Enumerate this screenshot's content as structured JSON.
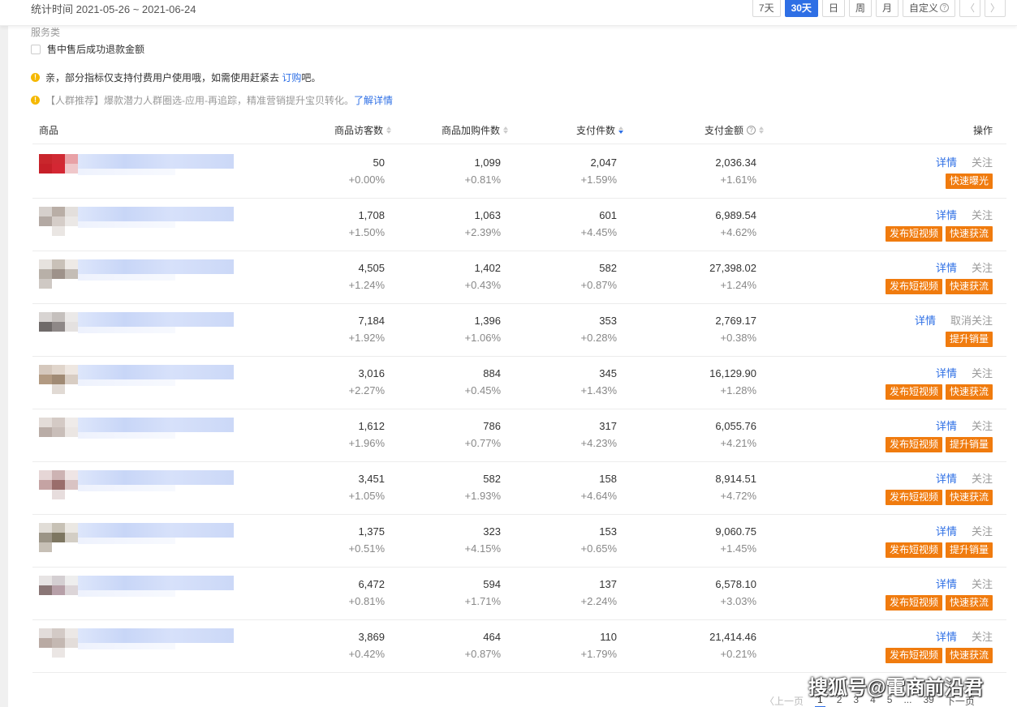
{
  "header": {
    "stat_time": "统计时间 2021-05-26 ~ 2021-06-24",
    "ranges": [
      "7天",
      "30天",
      "日",
      "周",
      "月"
    ],
    "active_range": "30天",
    "custom_label": "自定义",
    "prev_icon": "chevron-left-icon",
    "next_icon": "chevron-right-icon"
  },
  "filters": {
    "group_label": "服务类",
    "item_label": "售中售后成功退款金额"
  },
  "notices": [
    {
      "text": "亲，部分指标仅支持付费用户使用哦，如需使用赶紧去 ",
      "link": "订购",
      "suffix": "吧。"
    },
    {
      "text": "【人群推荐】爆款潜力人群圈选-应用-再追踪，精准营销提升宝贝转化。",
      "link": "了解详情",
      "suffix": ""
    }
  ],
  "table": {
    "columns": {
      "product": "商品",
      "visitors": "商品访客数",
      "cart": "商品加购件数",
      "qty": "支付件数",
      "amount": "支付金额",
      "ops": "操作"
    },
    "rows": [
      {
        "visitors": "50",
        "visitors_chg": "+0.00%",
        "cart": "1,099",
        "cart_chg": "+0.81%",
        "qty": "2,047",
        "qty_chg": "+1.59%",
        "amount": "2,036.34",
        "amount_chg": "+1.61%",
        "detail": "详情",
        "follow": "关注",
        "buttons": [
          "快速曝光"
        ],
        "thumb": [
          "#c9262c",
          "#d02a33",
          "#e8a1a6",
          "#c61f28",
          "#d42733",
          "#efc7ca",
          "#ffffff",
          "#ffffff",
          "#ffffff"
        ]
      },
      {
        "visitors": "1,708",
        "visitors_chg": "+1.50%",
        "cart": "1,063",
        "cart_chg": "+2.39%",
        "qty": "601",
        "qty_chg": "+4.45%",
        "amount": "6,989.54",
        "amount_chg": "+4.62%",
        "detail": "详情",
        "follow": "关注",
        "buttons": [
          "发布短视频",
          "快速获流"
        ],
        "thumb": [
          "#d6d0cc",
          "#b9aea6",
          "#e3dfdc",
          "#b3a9a3",
          "#d5cdc8",
          "#ebe8e6",
          "#ffffff",
          "#eae6e3",
          "#ffffff"
        ]
      },
      {
        "visitors": "4,505",
        "visitors_chg": "+1.24%",
        "cart": "1,402",
        "cart_chg": "+0.43%",
        "qty": "582",
        "qty_chg": "+0.87%",
        "amount": "27,398.02",
        "amount_chg": "+1.24%",
        "detail": "详情",
        "follow": "关注",
        "buttons": [
          "发布短视频",
          "快速获流"
        ],
        "thumb": [
          "#e6e2de",
          "#c9c1b8",
          "#eeeae6",
          "#b8b0a8",
          "#9e928a",
          "#c4bdb6",
          "#cfc9c4",
          "#ffffff",
          "#ffffff"
        ]
      },
      {
        "visitors": "7,184",
        "visitors_chg": "+1.92%",
        "cart": "1,396",
        "cart_chg": "+1.06%",
        "qty": "353",
        "qty_chg": "+0.28%",
        "amount": "2,769.17",
        "amount_chg": "+0.38%",
        "detail": "详情",
        "follow": "取消关注",
        "buttons": [
          "提升销量"
        ],
        "thumb": [
          "#d8d4d2",
          "#c5c0bd",
          "#ebe9e8",
          "#6f6a69",
          "#8e8887",
          "#e4e1e0",
          "#ffffff",
          "#ffffff",
          "#ffffff"
        ]
      },
      {
        "visitors": "3,016",
        "visitors_chg": "+2.27%",
        "cart": "884",
        "cart_chg": "+0.45%",
        "qty": "345",
        "qty_chg": "+1.43%",
        "amount": "16,129.90",
        "amount_chg": "+1.28%",
        "detail": "详情",
        "follow": "关注",
        "buttons": [
          "发布短视频",
          "快速获流"
        ],
        "thumb": [
          "#d5c8bd",
          "#e0d5cb",
          "#eee7e1",
          "#b29a82",
          "#a08a74",
          "#d8cdc3",
          "#ffffff",
          "#e1dad4",
          "#ffffff"
        ]
      },
      {
        "visitors": "1,612",
        "visitors_chg": "+1.96%",
        "cart": "786",
        "cart_chg": "+0.77%",
        "qty": "317",
        "qty_chg": "+4.23%",
        "amount": "6,055.76",
        "amount_chg": "+4.21%",
        "detail": "详情",
        "follow": "关注",
        "buttons": [
          "发布短视频",
          "提升销量"
        ],
        "thumb": [
          "#e3dcd8",
          "#d4cac5",
          "#efebe9",
          "#b9aca6",
          "#c9beb9",
          "#ebe6e3",
          "#ffffff",
          "#ffffff",
          "#ffffff"
        ]
      },
      {
        "visitors": "3,451",
        "visitors_chg": "+1.05%",
        "cart": "582",
        "cart_chg": "+1.93%",
        "qty": "158",
        "qty_chg": "+4.64%",
        "amount": "8,914.51",
        "amount_chg": "+4.72%",
        "detail": "详情",
        "follow": "关注",
        "buttons": [
          "发布短视频",
          "快速获流"
        ],
        "thumb": [
          "#e6d6d6",
          "#cdb3b3",
          "#efe5e5",
          "#c5a3a3",
          "#9a6d6b",
          "#d9c3c3",
          "#ffffff",
          "#e7dddd",
          "#ffffff"
        ]
      },
      {
        "visitors": "1,375",
        "visitors_chg": "+0.51%",
        "cart": "323",
        "cart_chg": "+4.15%",
        "qty": "153",
        "qty_chg": "+0.65%",
        "amount": "9,060.75",
        "amount_chg": "+1.45%",
        "detail": "详情",
        "follow": "关注",
        "buttons": [
          "发布短视频",
          "提升销量"
        ],
        "thumb": [
          "#e1ddd7",
          "#c7c1b5",
          "#ebe8e3",
          "#9b9486",
          "#7d7661",
          "#d3cec5",
          "#c7c0b6",
          "#ffffff",
          "#ffffff"
        ]
      },
      {
        "visitors": "6,472",
        "visitors_chg": "+0.81%",
        "cart": "594",
        "cart_chg": "+1.71%",
        "qty": "137",
        "qty_chg": "+2.24%",
        "amount": "6,578.10",
        "amount_chg": "+3.03%",
        "detail": "详情",
        "follow": "关注",
        "buttons": [
          "发布短视频",
          "快速获流"
        ],
        "thumb": [
          "#e7e4e4",
          "#d4cfd2",
          "#eeeeee",
          "#8a7676",
          "#b7a0a8",
          "#dcd5d8",
          "#ffffff",
          "#ffffff",
          "#ffffff"
        ]
      },
      {
        "visitors": "3,869",
        "visitors_chg": "+0.42%",
        "cart": "464",
        "cart_chg": "+0.87%",
        "qty": "110",
        "qty_chg": "+1.79%",
        "amount": "21,414.46",
        "amount_chg": "+0.21%",
        "detail": "详情",
        "follow": "关注",
        "buttons": [
          "发布短视频",
          "快速获流"
        ],
        "thumb": [
          "#e2dcda",
          "#d3cac6",
          "#ece8e6",
          "#b9aaa3",
          "#c4b8b2",
          "#e3ddda",
          "#ffffff",
          "#ebe6e4",
          "#ffffff"
        ]
      }
    ]
  },
  "pagination": {
    "prev": "〈上一页",
    "pages": [
      "1",
      "2",
      "3",
      "4",
      "5",
      "...",
      "39"
    ],
    "current": "1",
    "next": "下一页"
  },
  "watermark": "搜狐号@電商前沿君"
}
